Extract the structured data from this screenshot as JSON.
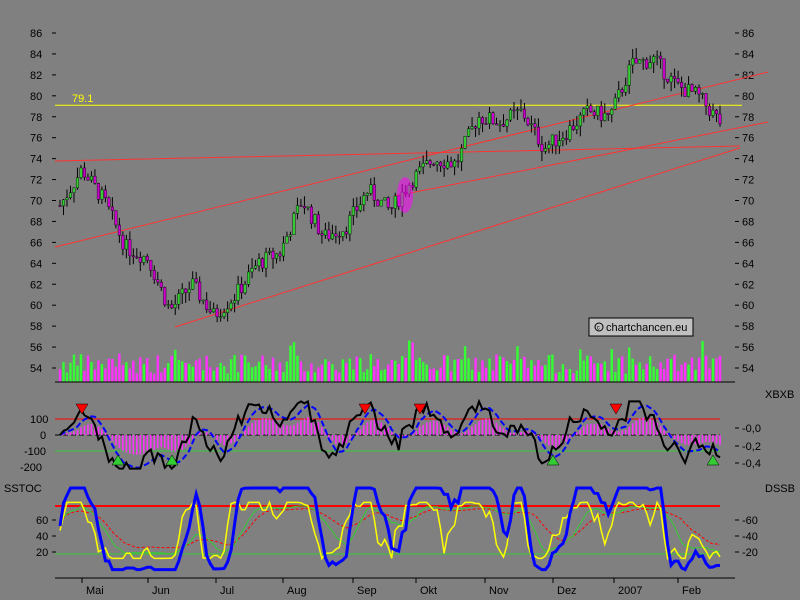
{
  "watermark": "chartchancen.eu",
  "colors": {
    "background": "#808080",
    "up_candle": "#33cc33",
    "down_candle": "#cc00cc",
    "resistance_line": "#ffff00",
    "trend_lines": "#ff3333",
    "volume_up": "#33ff33",
    "volume_down": "#ff33ff",
    "xbxb_line": "#000000",
    "xbxb_signal": "#0000ff",
    "xbxb_hist": "#ff33ff",
    "sstoc_line": "#0000ff",
    "dssb_line": "#ffff00",
    "green_line": "#33cc33",
    "red_line": "#ff0000"
  },
  "chart_data": [
    {
      "type": "candlestick",
      "title": "",
      "ylim": [
        52,
        87
      ],
      "y_ticks": [
        54,
        56,
        58,
        60,
        62,
        64,
        66,
        68,
        70,
        72,
        74,
        76,
        78,
        80,
        82,
        84,
        86
      ],
      "x_ticks": [
        "Mai",
        "Jun",
        "Jul",
        "Aug",
        "Sep",
        "Okt",
        "Nov",
        "Dez",
        "2007",
        "Feb"
      ],
      "resistance": {
        "value": 79.1,
        "label": "79.1"
      },
      "close_series": {
        "dates": [
          "2006-04-20",
          "2006-04-28",
          "2006-05-08",
          "2006-05-18",
          "2006-05-30",
          "2006-06-08",
          "2006-06-16",
          "2006-06-26",
          "2006-07-05",
          "2006-07-17",
          "2006-07-28",
          "2006-08-08",
          "2006-08-18",
          "2006-08-28",
          "2006-09-08",
          "2006-09-18",
          "2006-09-28",
          "2006-10-09",
          "2006-10-20",
          "2006-10-31",
          "2006-11-10",
          "2006-11-22",
          "2006-12-01",
          "2006-12-11",
          "2006-12-21",
          "2007-01-02",
          "2007-01-10",
          "2007-01-19",
          "2007-01-29",
          "2007-02-07",
          "2007-02-16"
        ],
        "values": [
          69.5,
          73.0,
          70.0,
          65.5,
          64.5,
          59.5,
          62.0,
          59.0,
          61.0,
          64.0,
          65.0,
          70.0,
          66.5,
          67.5,
          71.0,
          69.0,
          72.0,
          74.0,
          73.5,
          78.0,
          77.5,
          78.5,
          75.0,
          76.5,
          78.5,
          78.0,
          83.0,
          83.5,
          81.0,
          80.0,
          77.5
        ]
      },
      "volume": {
        "ylim_note": "bars only, no axis"
      }
    },
    {
      "type": "line",
      "name": "XBXB",
      "ylim": [
        -0.45,
        0.12
      ],
      "left_ticks": [
        "100",
        "0",
        "-100",
        "-200"
      ],
      "right_ticks": [
        "-0,0",
        "-0,2",
        "-0,4"
      ],
      "reference_lines": [
        100,
        0,
        -100
      ]
    },
    {
      "type": "line",
      "names": [
        "SSTOC",
        "DSSB"
      ],
      "ylim": [
        0,
        100
      ],
      "left_ticks": [
        60,
        40,
        20
      ],
      "right_ticks": [
        60,
        40,
        20
      ],
      "left_labels": [
        "60",
        "40",
        "20"
      ],
      "right_labels": [
        "-60",
        "-40",
        "-20"
      ],
      "reference_lines": [
        80,
        20
      ]
    }
  ]
}
